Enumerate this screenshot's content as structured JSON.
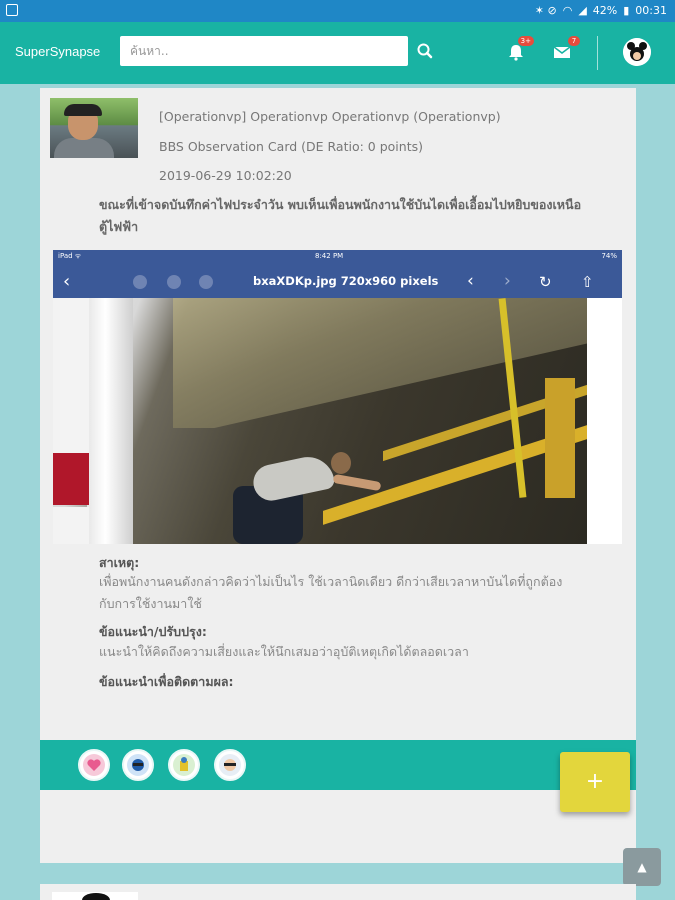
{
  "status_bar": {
    "signal": "◣",
    "wifi": "▾",
    "battery_percent": "42%",
    "time": "00:31"
  },
  "header": {
    "brand": "SuperSynapse",
    "search_placeholder": "ค้นหา..",
    "notifications_count": "3+",
    "messages_count": "7"
  },
  "post": {
    "author": "[Operationvp] Operationvp Operationvp (Operationvp)",
    "card_type": "BBS Observation Card (DE Ratio: 0 points)",
    "date": "2019-06-29 10:02:20",
    "description": "ขณะที่เข้าจดบันทึกค่าไฟประจำวัน พบเห็นเพื่อนพนักงานใช้บันไดเพื่อเอื้อมไปหยิบของเหนือตู้ไฟฟ้า",
    "image": {
      "ios_device": "iPad ᯤ",
      "ios_time": "8:42 PM",
      "ios_battery": "74%",
      "title": "bxaXDKp.jpg 720x960 pixels"
    },
    "cause_label": "สาเหตุ:",
    "cause_text": " เพื่อพนักงานคนดังกล่าวคิดว่าไม่เป็นไร ใช้เวลานิดเดียว ดีกว่าเสียเวลาหาบันไดที่ถูกต้องกับการใช้งานมาใช้",
    "suggestion_label": "ข้อแนะนำ/ปรับปรุง:",
    "suggestion_text": " แนะนำให้คิดถึงความเสี่ยงและให้นึกเสมอว่าอุบัติเหตุเกิดได้ตลอดเวลา",
    "followup_label": "ข้อแนะนำเพื่อติดตามผล:"
  },
  "stickers": [
    "love-it-sticker",
    "share-it-sticker",
    "trust-it-sticker",
    "comment-it-sticker"
  ],
  "fab_label": "+",
  "scroll_top_label": "▲",
  "colors": {
    "header": "#19b3a3",
    "status_bar": "#1f87c6",
    "background": "#9dd5d8",
    "fab": "#e3d63c",
    "badge": "#e74c3c"
  }
}
